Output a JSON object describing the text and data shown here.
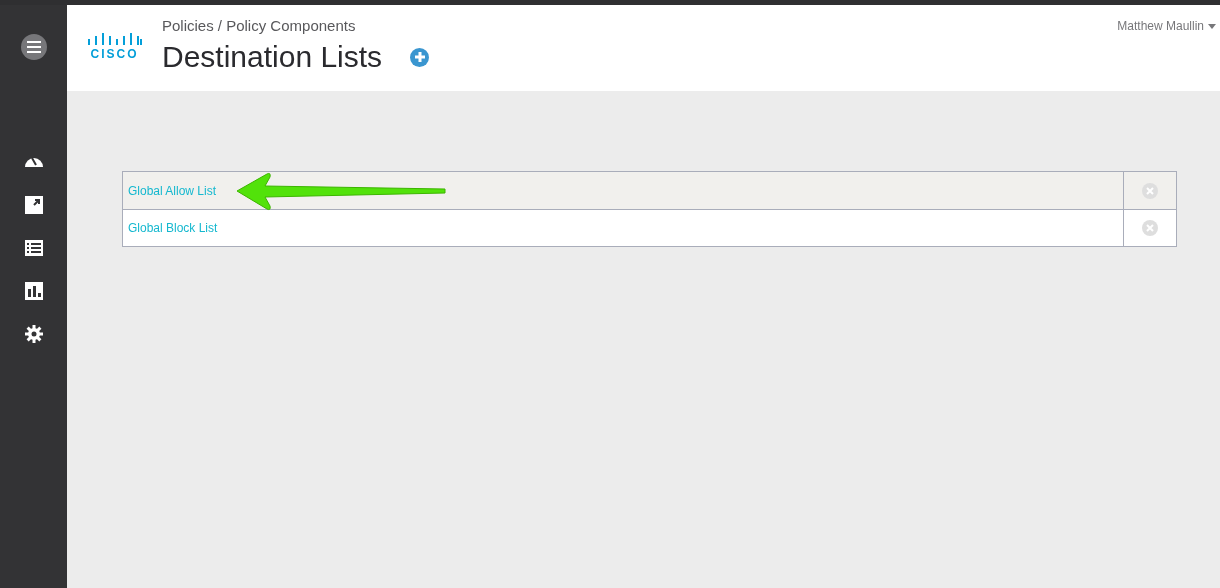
{
  "header": {
    "logo_text": "CISCO",
    "breadcrumb": "Policies / Policy Components",
    "title": "Destination Lists",
    "user": "Matthew Maullin"
  },
  "sidebar": {
    "items": [
      {
        "kind": "dashboard"
      },
      {
        "kind": "external"
      },
      {
        "kind": "list"
      },
      {
        "kind": "chart"
      },
      {
        "kind": "settings"
      }
    ]
  },
  "lists": [
    {
      "name": "Global Allow List",
      "highlighted": true
    },
    {
      "name": "Global Block List",
      "highlighted": false
    }
  ]
}
